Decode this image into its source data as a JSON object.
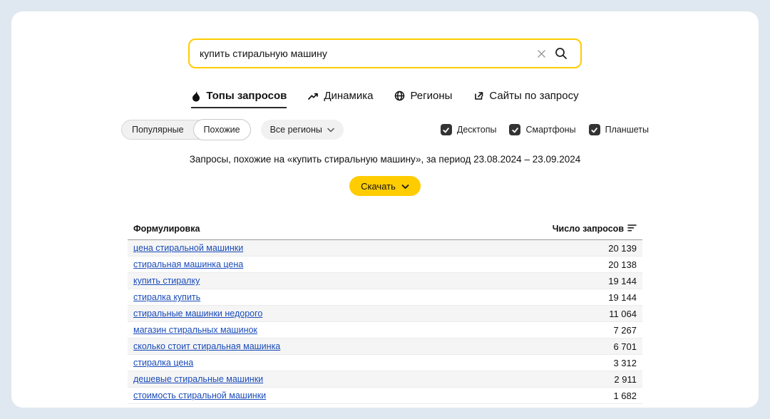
{
  "colors": {
    "accent_yellow": "#ffcc00",
    "link_blue": "#1a4bba",
    "checkbox_dark": "#333333",
    "page_background": "#dfe8f1"
  },
  "icons": {
    "search": "magnifier",
    "clear": "x-cross",
    "tab_top_queries": "flame",
    "tab_dynamics": "trend-line",
    "tab_regions": "globe",
    "tab_sites": "external-link",
    "checkbox": "checkmark",
    "dropdown": "chevron-down",
    "download": "chevron-down",
    "sort": "sort-descending-bars"
  },
  "search": {
    "value": "купить стиральную машину",
    "placeholder": ""
  },
  "tabs": [
    {
      "label": "Топы запросов",
      "active": true
    },
    {
      "label": "Динамика",
      "active": false
    },
    {
      "label": "Регионы",
      "active": false
    },
    {
      "label": "Сайты по запросу",
      "active": false
    }
  ],
  "filters": {
    "segments": [
      "Популярные",
      "Похожие"
    ],
    "selected_segment": "Похожие",
    "region_dropdown": "Все регионы",
    "devices": [
      {
        "label": "Десктопы",
        "checked": true
      },
      {
        "label": "Смартфоны",
        "checked": true
      },
      {
        "label": "Планшеты",
        "checked": true
      }
    ]
  },
  "summary": "Запросы, похожие на «купить стиральную машину», за период 23.08.2024 – 23.09.2024",
  "download_button": "Скачать",
  "table": {
    "columns": [
      "Формулировка",
      "Число запросов"
    ],
    "rows": [
      {
        "phrase": "цена стиральной машинки",
        "count": "20 139"
      },
      {
        "phrase": "стиральная машинка цена",
        "count": "20 138"
      },
      {
        "phrase": "купить стиралку",
        "count": "19 144"
      },
      {
        "phrase": "стиралка купить",
        "count": "19 144"
      },
      {
        "phrase": "стиральные машинки недорого",
        "count": "11 064"
      },
      {
        "phrase": "магазин стиральных машинок",
        "count": "7 267"
      },
      {
        "phrase": "сколько стоит стиральная машинка",
        "count": "6 701"
      },
      {
        "phrase": "стиралка цена",
        "count": "3 312"
      },
      {
        "phrase": "дешевые стиральные машинки",
        "count": "2 911"
      },
      {
        "phrase": "стоимость стиральной машинки",
        "count": "1 682"
      }
    ]
  }
}
